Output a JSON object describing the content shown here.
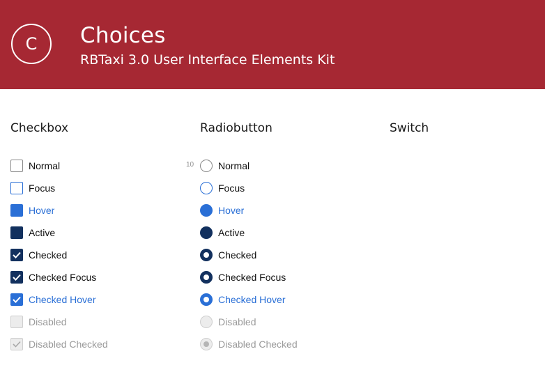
{
  "header": {
    "logo_letter": "C",
    "title": "Choices",
    "subtitle": "RBTaxi 3.0 User Interface Elements Kit"
  },
  "sections": {
    "checkbox_title": "Checkbox",
    "radio_title": "Radiobutton",
    "switch_title": "Switch"
  },
  "checkbox_items": [
    {
      "label": "Normal"
    },
    {
      "label": "Focus"
    },
    {
      "label": "Hover"
    },
    {
      "label": "Active"
    },
    {
      "label": "Checked"
    },
    {
      "label": "Checked Focus"
    },
    {
      "label": "Checked Hover"
    },
    {
      "label": "Disabled"
    },
    {
      "label": "Disabled Checked"
    }
  ],
  "radio_items": [
    {
      "label": "Normal"
    },
    {
      "label": "Focus"
    },
    {
      "label": "Hover"
    },
    {
      "label": "Active"
    },
    {
      "label": "Checked"
    },
    {
      "label": "Checked Focus"
    },
    {
      "label": "Checked Hover"
    },
    {
      "label": "Disabled"
    },
    {
      "label": "Disabled Checked"
    }
  ],
  "radio_marker": "10",
  "colors": {
    "brand_red": "#a62833",
    "accent_blue": "#2a6fd6",
    "navy": "#12305e",
    "disabled_gray": "#9a9a9a"
  },
  "icons": {
    "check": "checkmark-icon"
  }
}
